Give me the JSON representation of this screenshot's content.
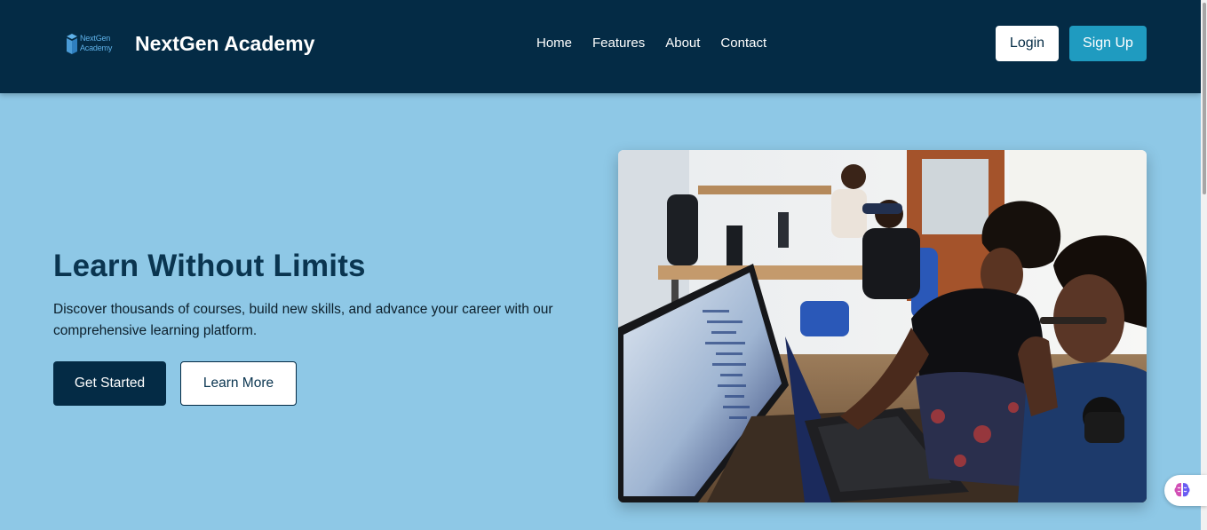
{
  "header": {
    "logo_text": [
      "NextGen",
      "Academy"
    ],
    "brand": "NextGen Academy",
    "nav": [
      {
        "label": "Home"
      },
      {
        "label": "Features"
      },
      {
        "label": "About"
      },
      {
        "label": "Contact"
      }
    ],
    "login_label": "Login",
    "signup_label": "Sign Up"
  },
  "hero": {
    "title": "Learn Without Limits",
    "description": "Discover thousands of courses, build new skills, and advance your career with our comprehensive learning platform.",
    "primary_button": "Get Started",
    "secondary_button": "Learn More"
  },
  "colors": {
    "navbar_bg": "#042b45",
    "hero_bg": "#8ec8e6",
    "accent": "#1f9bc0",
    "logo_blue": "#5fb2ea"
  },
  "icons": {
    "logo": "book-stack-icon",
    "assistant": "brain-icon"
  }
}
